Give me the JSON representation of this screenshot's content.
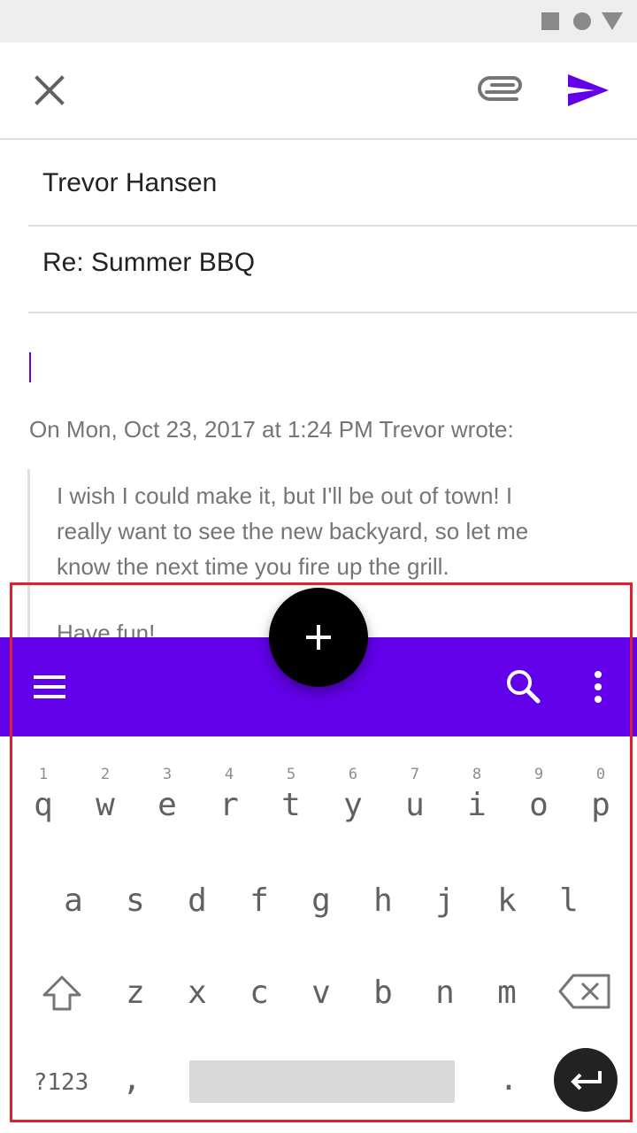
{
  "compose": {
    "to": "Trevor Hansen",
    "subject": "Re: Summer BBQ",
    "quote_header": "On Mon, Oct 23, 2017 at 1:24 PM Trevor wrote:",
    "quote_lines": [
      "I wish I could make it, but I'll be out of town! I",
      "really want to see the new backyard, so let me",
      "know the next time you fire up the grill."
    ],
    "quote_sign": "Have fun!"
  },
  "toolbar": {
    "close_icon": "close-icon",
    "attach_icon": "paperclip-icon",
    "send_icon": "send-icon"
  },
  "appbar": {
    "menu_icon": "menu-icon",
    "search_icon": "search-icon",
    "more_icon": "more-vert-icon",
    "fab_icon": "plus-icon"
  },
  "keyboard": {
    "row1": [
      {
        "hint": "1",
        "ch": "q"
      },
      {
        "hint": "2",
        "ch": "w"
      },
      {
        "hint": "3",
        "ch": "e"
      },
      {
        "hint": "4",
        "ch": "r"
      },
      {
        "hint": "5",
        "ch": "t"
      },
      {
        "hint": "6",
        "ch": "y"
      },
      {
        "hint": "7",
        "ch": "u"
      },
      {
        "hint": "8",
        "ch": "i"
      },
      {
        "hint": "9",
        "ch": "o"
      },
      {
        "hint": "0",
        "ch": "p"
      }
    ],
    "row2": [
      "a",
      "s",
      "d",
      "f",
      "g",
      "h",
      "j",
      "k",
      "l"
    ],
    "row3": [
      "z",
      "x",
      "c",
      "v",
      "b",
      "n",
      "m"
    ],
    "symbols": "?123",
    "comma": ",",
    "period": "."
  },
  "colors": {
    "accent": "#6200ea",
    "fab": "#000000",
    "highlight": "#e0202a"
  }
}
